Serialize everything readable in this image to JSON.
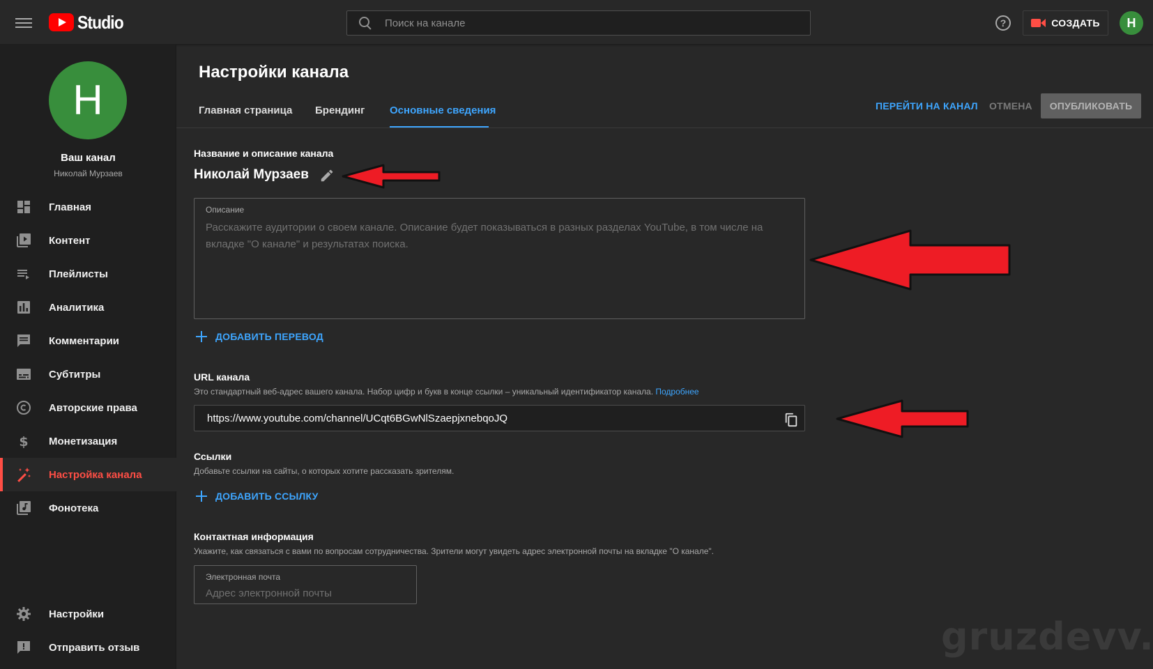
{
  "header": {
    "logo_text": "Studio",
    "search_placeholder": "Поиск на канале",
    "help_glyph": "?",
    "create_label": "СОЗДАТЬ",
    "avatar_letter": "Н"
  },
  "sidebar": {
    "avatar_letter": "Н",
    "channel_title": "Ваш канал",
    "channel_owner": "Николай Мурзаев",
    "items": [
      {
        "label": "Главная",
        "icon": "dashboard-icon"
      },
      {
        "label": "Контент",
        "icon": "video-library-icon"
      },
      {
        "label": "Плейлисты",
        "icon": "playlist-icon"
      },
      {
        "label": "Аналитика",
        "icon": "analytics-icon"
      },
      {
        "label": "Комментарии",
        "icon": "comment-icon"
      },
      {
        "label": "Субтитры",
        "icon": "subtitles-icon"
      },
      {
        "label": "Авторские права",
        "icon": "copyright-icon"
      },
      {
        "label": "Монетизация",
        "icon": "dollar-icon"
      },
      {
        "label": "Настройка канала",
        "icon": "magic-wand-icon",
        "active": true
      },
      {
        "label": "Фонотека",
        "icon": "music-library-icon"
      }
    ],
    "bottom_items": [
      {
        "label": "Настройки",
        "icon": "gear-icon"
      },
      {
        "label": "Отправить отзыв",
        "icon": "feedback-icon"
      }
    ]
  },
  "main": {
    "title": "Настройки канала",
    "tabs": [
      {
        "label": "Главная страница"
      },
      {
        "label": "Брендинг"
      },
      {
        "label": "Основные сведения",
        "active": true
      }
    ],
    "actions": {
      "goto_channel": "ПЕРЕЙТИ НА КАНАЛ",
      "cancel": "ОТМЕНА",
      "publish": "ОПУБЛИКОВАТЬ"
    },
    "name_section": {
      "heading": "Название и описание канала",
      "channel_name": "Николай Мурзаев",
      "description_label": "Описание",
      "description_placeholder": "Расскажите аудитории о своем канале. Описание будет показываться в разных разделах YouTube, в том числе на вкладке \"О канале\" и результатах поиска.",
      "add_translation": "ДОБАВИТЬ ПЕРЕВОД"
    },
    "url_section": {
      "heading": "URL канала",
      "text": "Это стандартный веб-адрес вашего канала. Набор цифр и букв в конце ссылки – уникальный идентификатор канала.",
      "more_link": "Подробнее",
      "url": "https://www.youtube.com/channel/UCqt6BGwNlSzaepjxnebqoJQ"
    },
    "links_section": {
      "heading": "Ссылки",
      "text": "Добавьте ссылки на сайты, о которых хотите рассказать зрителям.",
      "add_link": "ДОБАВИТЬ ССЫЛКУ"
    },
    "contact_section": {
      "heading": "Контактная информация",
      "text": "Укажите, как связаться с вами по вопросам сотрудничества. Зрители могут увидеть адрес электронной почты на вкладке \"О канале\".",
      "email_label": "Электронная почта",
      "email_placeholder": "Адрес электронной почты"
    }
  },
  "watermark": "gruzdevv.ru",
  "colors": {
    "background": "#282828",
    "sidebar": "#1f1f1f",
    "accent_blue": "#3ea6ff",
    "accent_red": "#ff4e45",
    "avatar_green": "#388e3c",
    "annotation_arrow": "#ee1c25"
  }
}
